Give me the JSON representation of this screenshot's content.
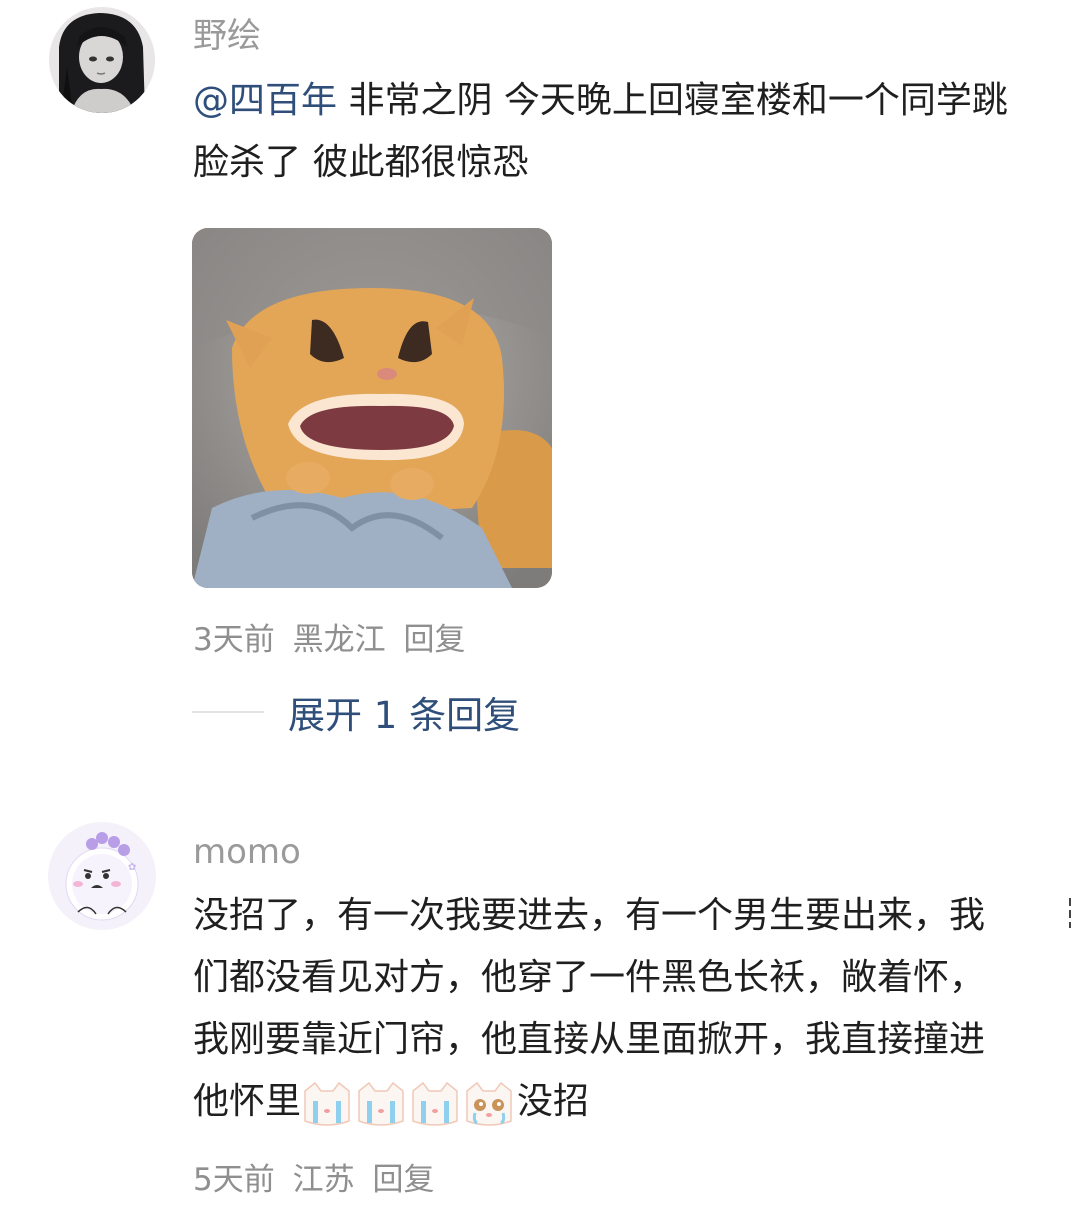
{
  "comments": [
    {
      "username": "野绘",
      "mention": "@四百年",
      "text": "非常之阴 今天晚上回寝室楼和一个同学跳脸杀了 彼此都很惊恐",
      "time": "3天前",
      "location": "黑龙江",
      "reply_label": "回复",
      "expand_label": "展开 1 条回复"
    },
    {
      "username": "momo",
      "text": "没招了，有一次我要进去，有一个男生要出来，我们都没看见对方，他穿了一件黑色长袄，敞着怀，我刚要靠近门帘，他直接从里面掀开，我直接撞进他怀里",
      "text_suffix": "没招",
      "emojis": [
        "crying-cat-emoji",
        "crying-cat-emoji",
        "crying-cat-emoji",
        "teary-cat-emoji"
      ],
      "time": "5天前",
      "location": "江苏",
      "reply_label": "回复"
    }
  ],
  "colors": {
    "mention": "#2f4f7a",
    "meta": "#8f8f8f",
    "username": "#9a9a9a",
    "text": "#1f1f1f"
  }
}
